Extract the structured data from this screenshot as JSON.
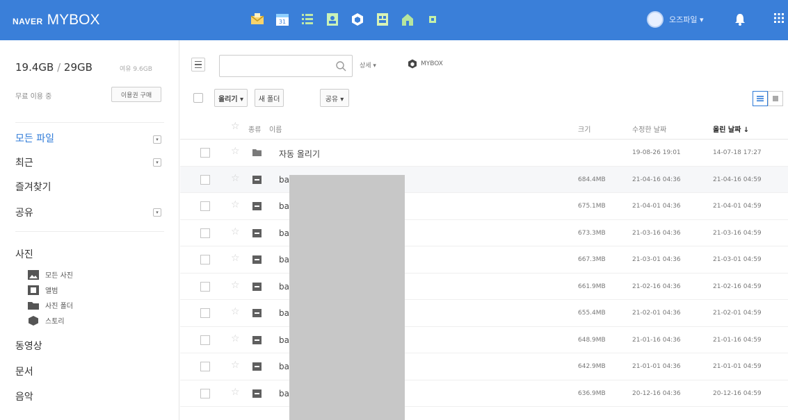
{
  "header": {
    "brand_naver": "NAVER",
    "brand_product": "MYBOX",
    "apps": [
      {
        "icon": "mail-icon",
        "color": "#f7d36b"
      },
      {
        "icon": "calendar-icon",
        "color": "#8fd0ff"
      },
      {
        "icon": "list-icon",
        "color": "#bfe9a8"
      },
      {
        "icon": "contacts-icon",
        "color": "#c9f2b8"
      },
      {
        "icon": "mybox-cube-icon",
        "color": "#ffffff"
      },
      {
        "icon": "office-icon",
        "color": "#d8f3b6"
      },
      {
        "icon": "cafe-icon",
        "color": "#b6e59e"
      },
      {
        "icon": "memo-icon",
        "color": "#c4f0a8"
      }
    ],
    "user_name": "오즈파일 ▾"
  },
  "sidebar": {
    "quota_used": "19.4GB",
    "quota_sep": " / ",
    "quota_total": "29GB",
    "quota_left": "여유 9.6GB",
    "in_use_label": "무료 이용 중",
    "buy_button": "이용권 구매",
    "nav": [
      {
        "label": "모든 파일",
        "active": true,
        "has_arrow": true
      },
      {
        "label": "최근",
        "active": false,
        "has_arrow": true
      },
      {
        "label": "즐겨찾기",
        "active": false,
        "has_arrow": false
      },
      {
        "label": "공유",
        "active": false,
        "has_arrow": true
      }
    ],
    "photo_section": "사진",
    "photo_items": [
      {
        "label": "모든 사진",
        "icon": "photo-icon"
      },
      {
        "label": "앨범",
        "icon": "album-icon"
      },
      {
        "label": "사진 폴더",
        "icon": "folder-icon"
      },
      {
        "label": "스토리",
        "icon": "story-icon"
      }
    ],
    "bottom_nav": [
      "동영상",
      "문서",
      "음악"
    ]
  },
  "main": {
    "search": {
      "value": "",
      "placeholder": ""
    },
    "detail_label": "상세 ▾",
    "location_label": "MYBOX",
    "toolbar": {
      "upload": "올리기 ▾",
      "new_folder": "새 폴더",
      "share": "공유 ▾"
    },
    "columns": {
      "type": "종류",
      "name": "이름",
      "size": "크기",
      "modified": "수정한 날짜",
      "uploaded": "올린 날짜 ↓"
    },
    "rows": [
      {
        "type": "folder",
        "name": "자동 올리기",
        "size": "",
        "modified": "19-08-26 19:01",
        "uploaded": "14-07-18 17:27"
      },
      {
        "type": "file",
        "name": "ba",
        "size": "684.4MB",
        "modified": "21-04-16 04:36",
        "uploaded": "21-04-16 04:59"
      },
      {
        "type": "file",
        "name": "ba",
        "size": "675.1MB",
        "modified": "21-04-01 04:36",
        "uploaded": "21-04-01 04:59"
      },
      {
        "type": "file",
        "name": "ba",
        "size": "673.3MB",
        "modified": "21-03-16 04:36",
        "uploaded": "21-03-16 04:59"
      },
      {
        "type": "file",
        "name": "ba",
        "size": "667.3MB",
        "modified": "21-03-01 04:36",
        "uploaded": "21-03-01 04:59"
      },
      {
        "type": "file",
        "name": "ba",
        "size": "661.9MB",
        "modified": "21-02-16 04:36",
        "uploaded": "21-02-16 04:59"
      },
      {
        "type": "file",
        "name": "ba",
        "size": "655.4MB",
        "modified": "21-02-01 04:36",
        "uploaded": "21-02-01 04:59"
      },
      {
        "type": "file",
        "name": "ba",
        "size": "648.9MB",
        "modified": "21-01-16 04:36",
        "uploaded": "21-01-16 04:59"
      },
      {
        "type": "file",
        "name": "ba",
        "size": "642.9MB",
        "modified": "21-01-01 04:36",
        "uploaded": "21-01-01 04:59"
      },
      {
        "type": "file",
        "name": "ba",
        "size": "636.9MB",
        "modified": "20-12-16 04:36",
        "uploaded": "20-12-16 04:59"
      }
    ]
  },
  "colors": {
    "brand_blue": "#3a7fd9",
    "active_nav": "#2f7bd8"
  }
}
